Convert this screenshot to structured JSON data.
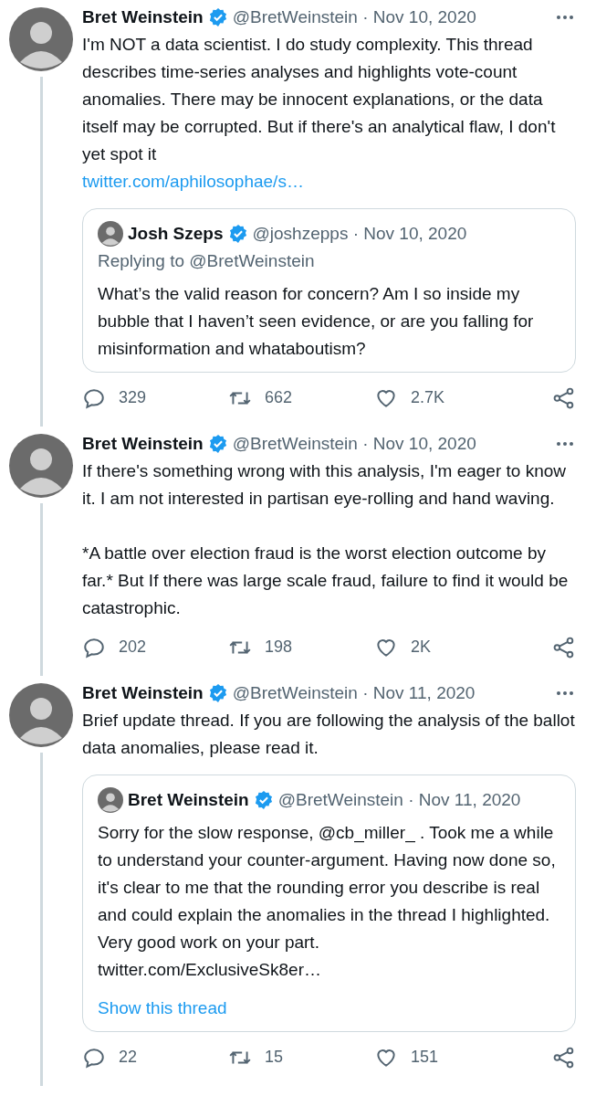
{
  "tweets": [
    {
      "author": {
        "name": "Bret Weinstein",
        "verified": true,
        "meta": "@BretWeinstein · Nov 10, 2020"
      },
      "thread_line": true,
      "paragraphs": [
        "I'm NOT a data scientist. I do study complexity. This thread describes time-series analyses and highlights vote-count anomalies. There may be innocent explanations, or the data itself may be corrupted. But if there's an analytical flaw, I don't yet spot it"
      ],
      "link": "twitter.com/aphilosophae/s…",
      "quote": {
        "author": {
          "name": "Josh Szeps",
          "verified": true,
          "meta": "@joshzepps · Nov 10, 2020"
        },
        "replying_to": "Replying to @BretWeinstein",
        "text": "What’s the valid reason for concern? Am I so inside my bubble that I haven’t seen evidence, or are you falling for misinformation and whataboutism?"
      },
      "actions": {
        "replies": "329",
        "retweets": "662",
        "likes": "2.7K"
      }
    },
    {
      "author": {
        "name": "Bret Weinstein",
        "verified": true,
        "meta": "@BretWeinstein · Nov 10, 2020"
      },
      "thread_line": true,
      "paragraphs": [
        "If there's something wrong with this analysis, I'm eager to know it. I am not interested in partisan eye-rolling and hand waving.",
        "*A battle over election fraud is the worst election outcome by far.* But If there was large scale fraud, failure to find it would be catastrophic."
      ],
      "actions": {
        "replies": "202",
        "retweets": "198",
        "likes": "2K"
      }
    },
    {
      "author": {
        "name": "Bret Weinstein",
        "verified": true,
        "meta": "@BretWeinstein · Nov 11, 2020"
      },
      "thread_line": true,
      "paragraphs": [
        "Brief update thread. If you are following the analysis of the ballot data anomalies, please read it."
      ],
      "quote": {
        "author": {
          "name": "Bret Weinstein",
          "verified": true,
          "meta": "@BretWeinstein · Nov 11, 2020"
        },
        "text": "Sorry for the slow response, @cb_miller_ . Took me a while to understand your counter-argument. Having now done so, it's clear to me that the rounding error you describe is real and could explain the anomalies in the thread I highlighted. Very good work on your part.",
        "link": "twitter.com/ExclusiveSk8er…",
        "show_thread": "Show this thread"
      },
      "actions": {
        "replies": "22",
        "retweets": "15",
        "likes": "151"
      }
    }
  ]
}
